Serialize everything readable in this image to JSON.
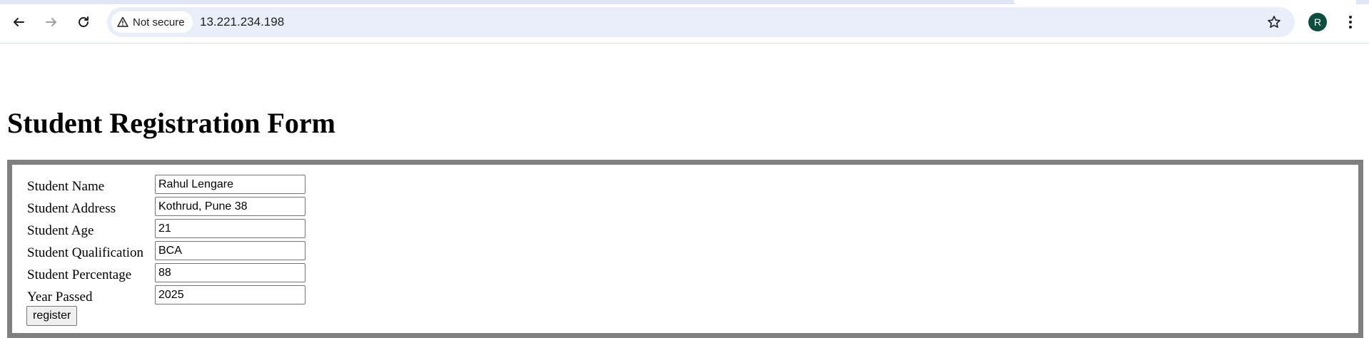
{
  "browser": {
    "security_chip": "Not secure",
    "url": "13.221.234.198",
    "profile_initial": "R",
    "icons": {
      "back": "arrow-left-icon",
      "forward": "arrow-right-icon",
      "reload": "reload-icon",
      "warning": "warning-icon",
      "bookmark": "star-icon",
      "menu": "kebab-menu-icon"
    },
    "colors": {
      "omnibox_bg": "#e9eef8",
      "avatar_bg": "#0d4e3f"
    }
  },
  "page": {
    "title": "Student Registration Form",
    "fields": [
      {
        "label": "Student Name",
        "value": "Rahul Lengare"
      },
      {
        "label": "Student Address",
        "value": "Kothrud, Pune 38"
      },
      {
        "label": "Student Age",
        "value": "21"
      },
      {
        "label": "Student Qualification",
        "value": "BCA"
      },
      {
        "label": "Student Percentage",
        "value": "88"
      },
      {
        "label": "Year Passed",
        "value": "2025"
      }
    ],
    "submit_label": "register",
    "colors": {
      "form_border": "#808080"
    }
  }
}
